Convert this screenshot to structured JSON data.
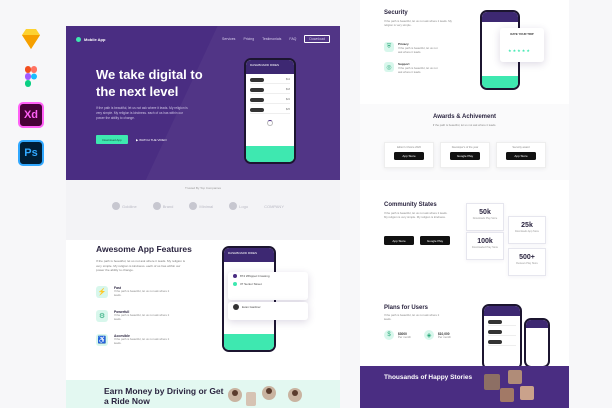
{
  "tools": [
    {
      "name": "sketch-icon",
      "label": ""
    },
    {
      "name": "figma-icon",
      "label": ""
    },
    {
      "name": "xd-icon",
      "label": "Xd"
    },
    {
      "name": "photoshop-icon",
      "label": "Ps"
    }
  ],
  "colors": {
    "primary": "#4a2d82",
    "accent": "#3ee8b0",
    "mint_bg": "#e3f8f1"
  },
  "hero": {
    "brand": "Mobile App",
    "nav": [
      "Services",
      "Pricing",
      "Testimonials",
      "FAQ"
    ],
    "nav_button": "Download",
    "title": "We take digital to the next level",
    "description": "If the path is beautiful, let us not ask where it leads. My religion is very simple. My religion is kindness. each of us has within our power the ability to change.",
    "cta": "Download App",
    "link": "WATCH THE VIDEO"
  },
  "phone": {
    "header": "DASHBOARD RIDES",
    "footer_text": "Set destination"
  },
  "partners": {
    "caption": "Trusted By Top Companies",
    "items": [
      "Goldline",
      "Brand",
      "Minimal",
      "Logo",
      "COMPANY"
    ]
  },
  "features": {
    "title": "Awesome App Features",
    "description": "If the path is beautiful, let us not ask where it leads. My religion is very simple. My religion is kindness. each of us has within our power the ability to change.",
    "items": [
      {
        "title": "Fast",
        "desc": "If the path is beautiful, let us not ask where it leads."
      },
      {
        "title": "Powerfull",
        "desc": "If the path is beautiful, let us not ask where it leads."
      },
      {
        "title": "Accesible",
        "desc": "If the path is beautiful, let us not ask where it leads."
      }
    ],
    "card_rows": [
      "874 Whippet Crossing",
      "37 Senior Street"
    ],
    "card_user": "Evan Gardner"
  },
  "earn": {
    "title": "Earn Money by Driving or Get a Ride Now"
  },
  "security": {
    "title": "Security",
    "desc": "If the path is beautiful, let us not ask where it leads. My religion is very simple.",
    "items": [
      {
        "label": "Privacy",
        "desc": "If the path is beautiful, let us not ask where it leads."
      },
      {
        "label": "Support",
        "desc": "If the path is beautiful, let us not ask where it leads."
      }
    ],
    "rate_label": "RATE YOUR TRIP",
    "stars": "★★★★★"
  },
  "awards": {
    "title": "Awards & Achivement",
    "subtitle": "If the path is beautiful, let us not ask where it leads.",
    "items": [
      {
        "caption": "Editor's Choice 2020",
        "store": "App Store"
      },
      {
        "caption": "Developer's of the year",
        "store": "Google Play"
      },
      {
        "caption": "Security award",
        "store": "App Store"
      }
    ]
  },
  "community": {
    "title": "Community States",
    "desc": "If the path is beautiful, let us not ask where it leads. My religion is very simple. My religion is kindness.",
    "stores": [
      "App Store",
      "Google Play"
    ],
    "stats": [
      {
        "value": "50k",
        "label": "Downloads Play Store"
      },
      {
        "value": "25k",
        "label": "Downloads App Store"
      },
      {
        "value": "100k",
        "label": "Downloaded Play Store"
      },
      {
        "value": "500+",
        "label": "Reviews Play Store"
      }
    ]
  },
  "plans": {
    "title": "Plans for Users",
    "desc": "If the path is beautiful, let us not ask where it leads.",
    "items": [
      {
        "value": "$3000",
        "label": "Per month"
      },
      {
        "value": "$10,000",
        "label": "Per month"
      }
    ]
  },
  "happy": {
    "title": "Thousands of Happy Stories"
  }
}
